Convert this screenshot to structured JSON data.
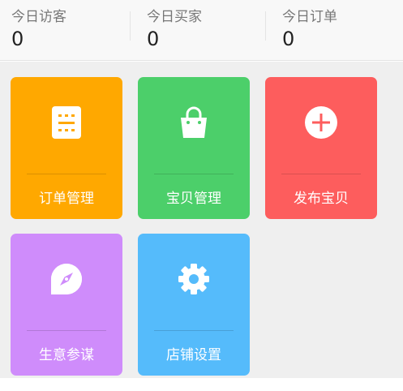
{
  "stats": [
    {
      "label": "今日访客",
      "value": "0"
    },
    {
      "label": "今日买家",
      "value": "0"
    },
    {
      "label": "今日订单",
      "value": "0"
    }
  ],
  "tiles": [
    {
      "label": "订单管理",
      "icon": "order-list-icon",
      "color": "#ffa800"
    },
    {
      "label": "宝贝管理",
      "icon": "shopping-bag-icon",
      "color": "#4ccf6a"
    },
    {
      "label": "发布宝贝",
      "icon": "add-circle-icon",
      "color": "#fd5d5d"
    },
    {
      "label": "生意参谋",
      "icon": "compass-icon",
      "color": "#cf8cfb"
    },
    {
      "label": "店铺设置",
      "icon": "gear-icon",
      "color": "#55bbfb"
    }
  ]
}
